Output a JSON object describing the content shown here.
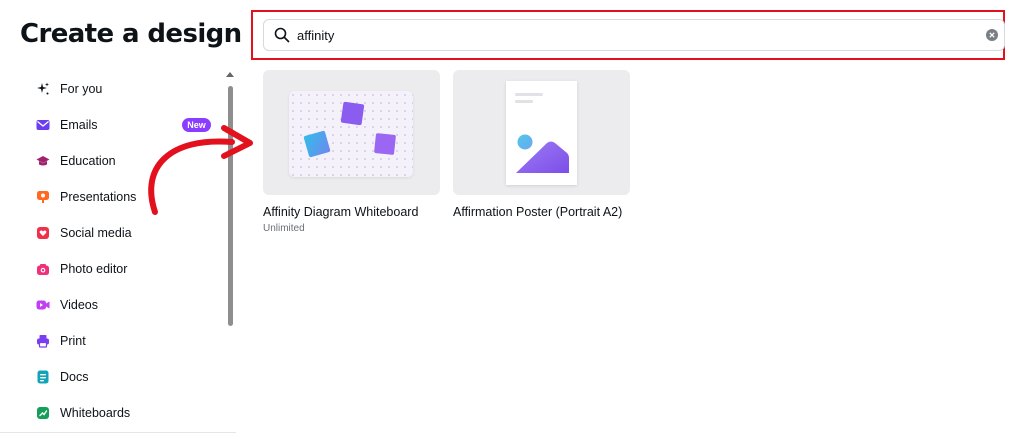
{
  "page_title": "Create a design",
  "search": {
    "value": "affinity",
    "placeholder": ""
  },
  "sidebar": {
    "items": [
      {
        "label": "For you",
        "icon": "sparkle-icon",
        "color": "#0e1318"
      },
      {
        "label": "Emails",
        "icon": "envelope-icon",
        "color": "#6a3df0",
        "badge": "New"
      },
      {
        "label": "Education",
        "icon": "graduation-cap-icon",
        "color": "#a1226b"
      },
      {
        "label": "Presentations",
        "icon": "presentation-icon",
        "color": "#ff6a1f"
      },
      {
        "label": "Social media",
        "icon": "heart-icon",
        "color": "#f0304a"
      },
      {
        "label": "Photo editor",
        "icon": "camera-icon",
        "color": "#f0307a"
      },
      {
        "label": "Videos",
        "icon": "video-icon",
        "color": "#c13ef2"
      },
      {
        "label": "Print",
        "icon": "printer-icon",
        "color": "#7b3df2"
      },
      {
        "label": "Docs",
        "icon": "document-icon",
        "color": "#13a3b8"
      },
      {
        "label": "Whiteboards",
        "icon": "whiteboard-icon",
        "color": "#14a05b"
      }
    ]
  },
  "results": [
    {
      "title": "Affinity Diagram Whiteboard",
      "subtitle": "Unlimited",
      "thumbnail": "whiteboard"
    },
    {
      "title": "Affirmation Poster (Portrait A2)",
      "subtitle": "",
      "thumbnail": "poster"
    }
  ],
  "colors": {
    "brand_purple": "#8b3dff",
    "highlight_red": "#e3101e",
    "annotation_arrow": "#e3101e"
  }
}
